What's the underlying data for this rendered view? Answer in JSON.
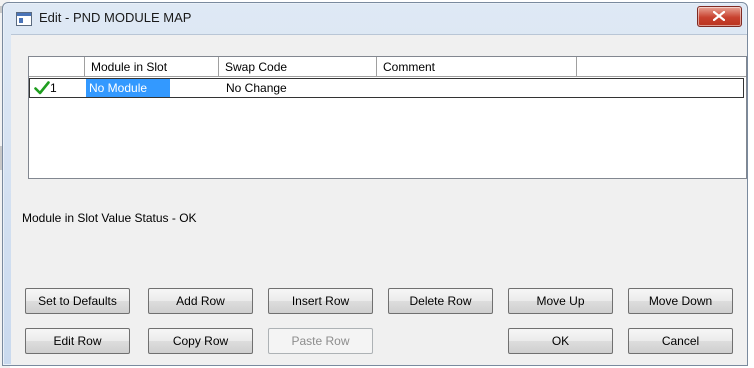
{
  "window": {
    "title": "Edit - PND MODULE MAP"
  },
  "grid": {
    "columns": [
      "",
      "Module in Slot",
      "Swap Code",
      "Comment",
      ""
    ],
    "rows": [
      {
        "status_icon": "check-icon",
        "index": "1",
        "module_in_slot": "No Module",
        "swap_code": "No Change",
        "comment": ""
      }
    ]
  },
  "status_text": "Module in Slot Value Status - OK",
  "buttons": {
    "set_to_defaults": "Set to Defaults",
    "add_row": "Add Row",
    "insert_row": "Insert Row",
    "delete_row": "Delete Row",
    "move_up": "Move Up",
    "move_down": "Move Down",
    "edit_row": "Edit Row",
    "copy_row": "Copy Row",
    "paste_row": "Paste Row",
    "ok": "OK",
    "cancel": "Cancel"
  },
  "colors": {
    "selection": "#3399ff",
    "check": "#1f9e1f",
    "close_button": "#c8412f"
  }
}
